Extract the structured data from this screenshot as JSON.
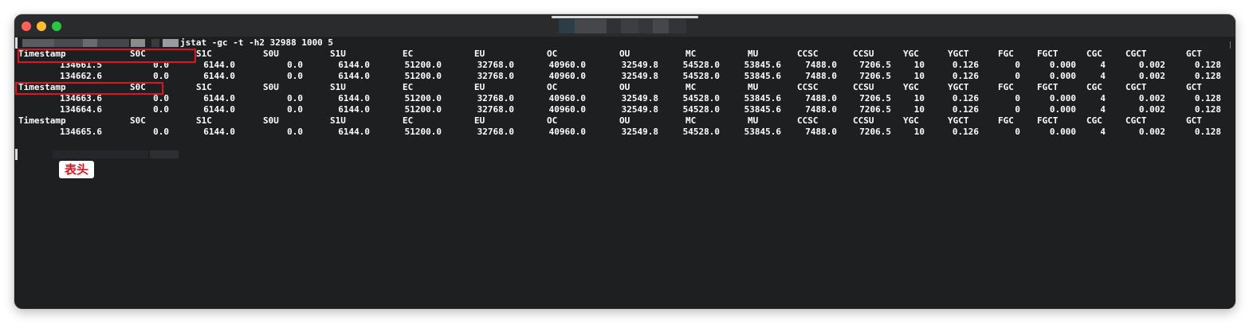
{
  "window": {
    "traffic_lights": [
      "close",
      "minimize",
      "zoom"
    ]
  },
  "terminal": {
    "command": "jstat -gc -t -h2 32988 1000 5",
    "header_columns": [
      "Timestamp",
      "S0C",
      "S1C",
      "S0U",
      "S1U",
      "EC",
      "EU",
      "OC",
      "OU",
      "MC",
      "MU",
      "CCSC",
      "CCSU",
      "YGC",
      "YGCT",
      "FGC",
      "FGCT",
      "CGC",
      "CGCT",
      "GCT"
    ],
    "lines": [
      {
        "kind": "header",
        "cells": [
          "Timestamp",
          "S0C",
          "S1C",
          "S0U",
          "S1U",
          "EC",
          "EU",
          "OC",
          "OU",
          "MC",
          "MU",
          "CCSC",
          "CCSU",
          "YGC",
          "YGCT",
          "FGC",
          "FGCT",
          "CGC",
          "CGCT",
          "GCT"
        ]
      },
      {
        "kind": "data",
        "cells": [
          "134661.5",
          "0.0",
          "6144.0",
          "0.0",
          "6144.0",
          "51200.0",
          "32768.0",
          "40960.0",
          "32549.8",
          "54528.0",
          "53845.6",
          "7488.0",
          "7206.5",
          "10",
          "0.126",
          "0",
          "0.000",
          "4",
          "0.002",
          "0.128"
        ]
      },
      {
        "kind": "data",
        "cells": [
          "134662.6",
          "0.0",
          "6144.0",
          "0.0",
          "6144.0",
          "51200.0",
          "32768.0",
          "40960.0",
          "32549.8",
          "54528.0",
          "53845.6",
          "7488.0",
          "7206.5",
          "10",
          "0.126",
          "0",
          "0.000",
          "4",
          "0.002",
          "0.128"
        ]
      },
      {
        "kind": "header",
        "cells": [
          "Timestamp",
          "S0C",
          "S1C",
          "S0U",
          "S1U",
          "EC",
          "EU",
          "OC",
          "OU",
          "MC",
          "MU",
          "CCSC",
          "CCSU",
          "YGC",
          "YGCT",
          "FGC",
          "FGCT",
          "CGC",
          "CGCT",
          "GCT"
        ]
      },
      {
        "kind": "data",
        "cells": [
          "134663.6",
          "0.0",
          "6144.0",
          "0.0",
          "6144.0",
          "51200.0",
          "32768.0",
          "40960.0",
          "32549.8",
          "54528.0",
          "53845.6",
          "7488.0",
          "7206.5",
          "10",
          "0.126",
          "0",
          "0.000",
          "4",
          "0.002",
          "0.128"
        ]
      },
      {
        "kind": "data",
        "cells": [
          "134664.6",
          "0.0",
          "6144.0",
          "0.0",
          "6144.0",
          "51200.0",
          "32768.0",
          "40960.0",
          "32549.8",
          "54528.0",
          "53845.6",
          "7488.0",
          "7206.5",
          "10",
          "0.126",
          "0",
          "0.000",
          "4",
          "0.002",
          "0.128"
        ]
      },
      {
        "kind": "header",
        "cells": [
          "Timestamp",
          "S0C",
          "S1C",
          "S0U",
          "S1U",
          "EC",
          "EU",
          "OC",
          "OU",
          "MC",
          "MU",
          "CCSC",
          "CCSU",
          "YGC",
          "YGCT",
          "FGC",
          "FGCT",
          "CGC",
          "CGCT",
          "GCT"
        ]
      },
      {
        "kind": "data",
        "cells": [
          "134665.6",
          "0.0",
          "6144.0",
          "0.0",
          "6144.0",
          "51200.0",
          "32768.0",
          "40960.0",
          "32549.8",
          "54528.0",
          "53845.6",
          "7488.0",
          "7206.5",
          "10",
          "0.126",
          "0",
          "0.000",
          "4",
          "0.002",
          "0.128"
        ]
      }
    ]
  },
  "annotation": {
    "label": "表头",
    "color": "#e0141e"
  },
  "colors": {
    "terminal_bg": "#1e1f21",
    "text": "#ffffff",
    "highlight": "#e0141e"
  }
}
